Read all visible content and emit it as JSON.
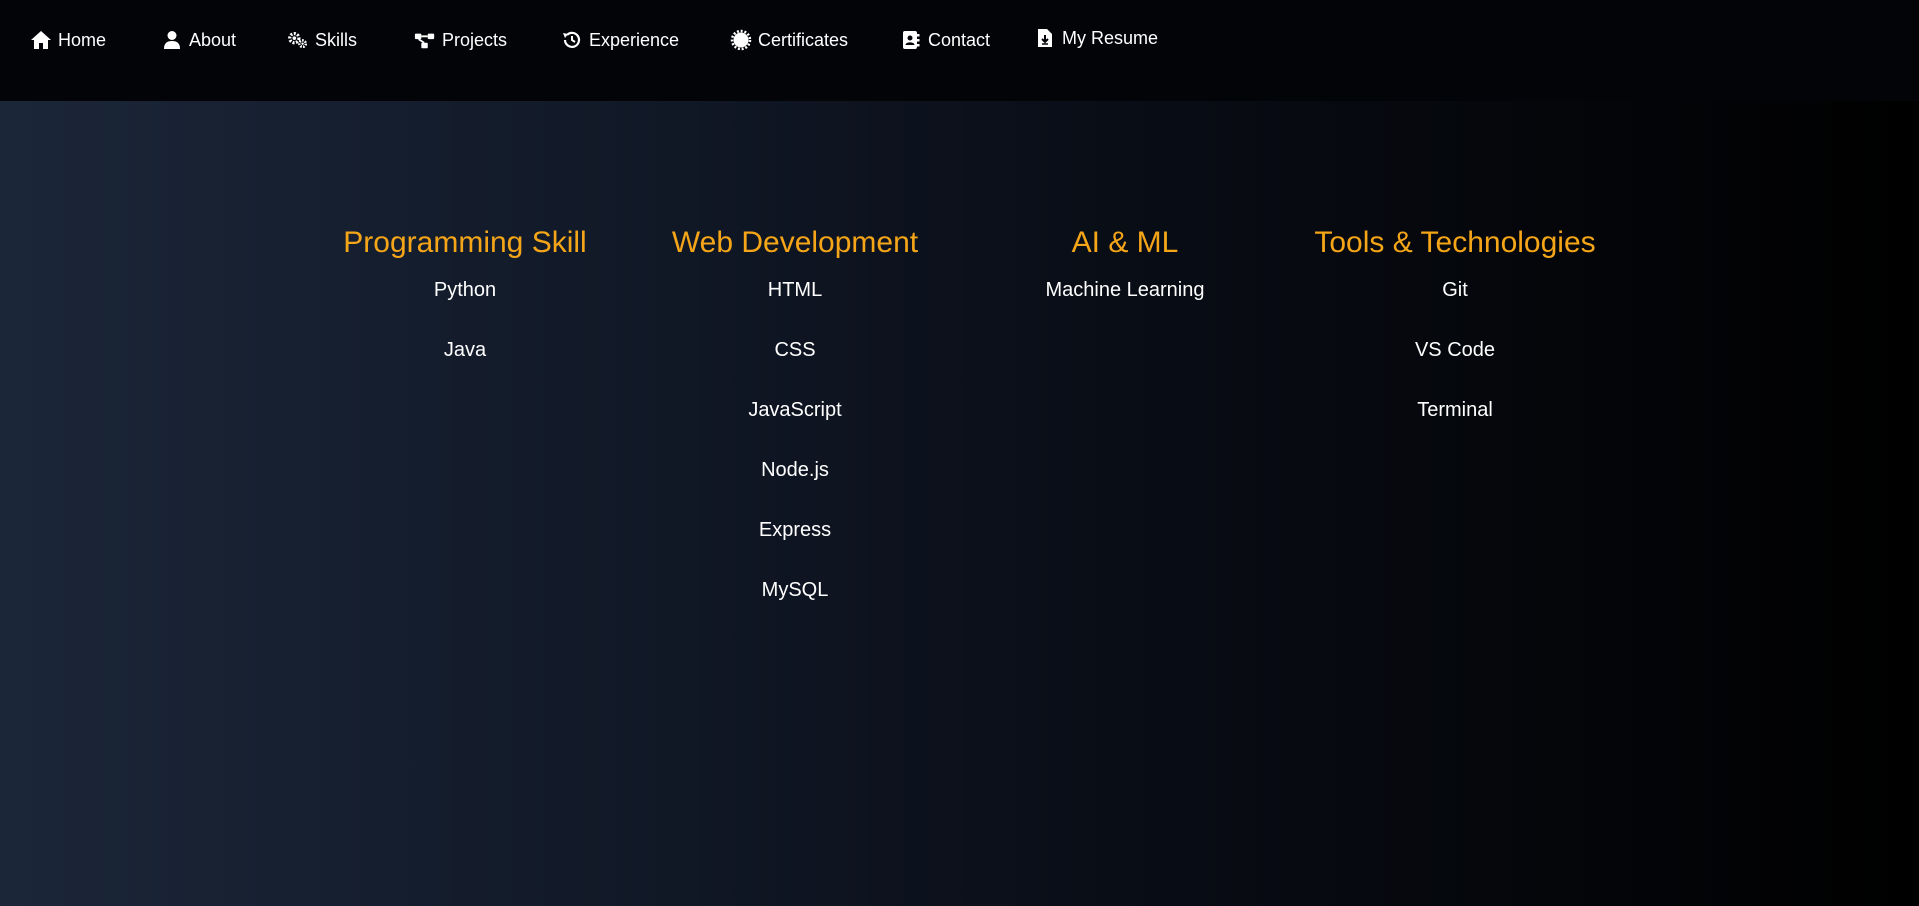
{
  "nav": {
    "items": [
      {
        "label": "Home",
        "icon": "home-icon"
      },
      {
        "label": "About",
        "icon": "user-icon"
      },
      {
        "label": "Skills",
        "icon": "gears-icon"
      },
      {
        "label": "Projects",
        "icon": "project-diagram-icon"
      },
      {
        "label": "Experience",
        "icon": "history-icon"
      },
      {
        "label": "Certificates",
        "icon": "certificate-icon"
      },
      {
        "label": "Contact",
        "icon": "address-book-icon"
      },
      {
        "label": "My Resume",
        "icon": "file-download-icon"
      }
    ]
  },
  "colors": {
    "accent": "#f5a518",
    "text": "#ffffff",
    "navbar_bg": "#020408"
  },
  "skills": [
    {
      "title": "Programming Skill",
      "items": [
        "Python",
        "Java"
      ]
    },
    {
      "title": "Web Development",
      "items": [
        "HTML",
        "CSS",
        "JavaScript",
        "Node.js",
        "Express",
        "MySQL"
      ]
    },
    {
      "title": "AI & ML",
      "items": [
        "Machine Learning"
      ]
    },
    {
      "title": "Tools & Technologies",
      "items": [
        "Git",
        "VS Code",
        "Terminal"
      ]
    }
  ]
}
